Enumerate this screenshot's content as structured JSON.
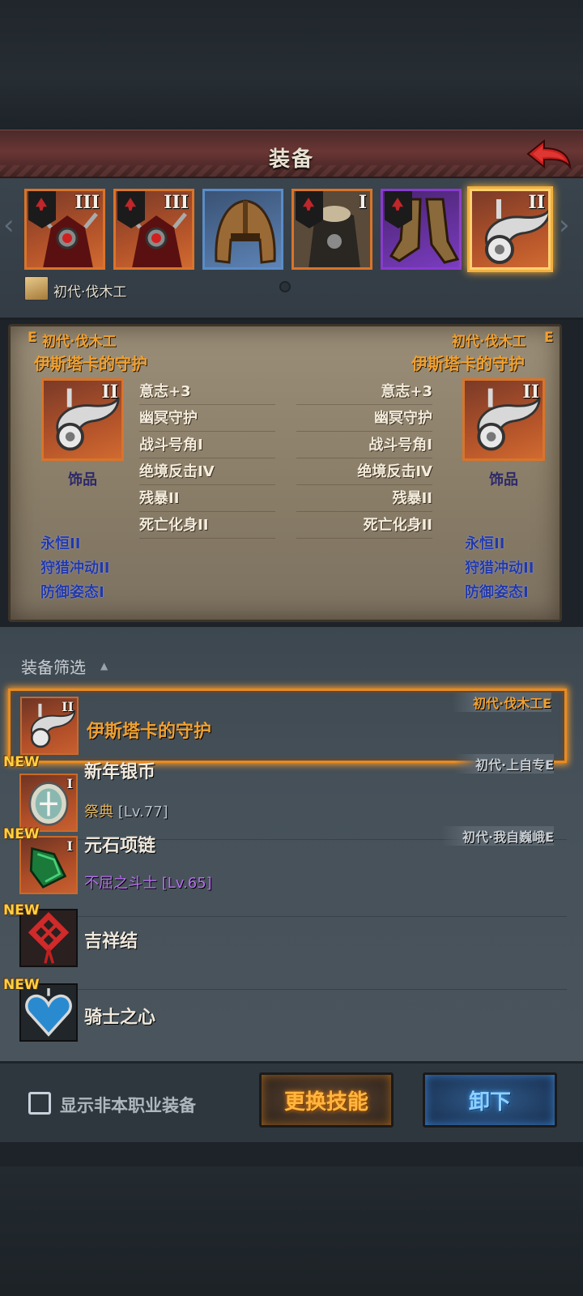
{
  "header": {
    "title": "装备"
  },
  "slots": [
    {
      "tier": "III",
      "frame": "orange",
      "icon": "demon-armor-icon"
    },
    {
      "tier": "III",
      "frame": "orange",
      "icon": "demon-armor-icon"
    },
    {
      "tier": "",
      "frame": "blue",
      "icon": "helmet-icon"
    },
    {
      "tier": "I",
      "frame": "orange",
      "icon": "fur-armor-icon"
    },
    {
      "tier": "",
      "frame": "purple",
      "icon": "boots-icon"
    },
    {
      "tier": "II",
      "frame": "orange",
      "icon": "horn-accessory-icon",
      "selected": true
    }
  ],
  "owner": {
    "name": "初代·伐木工"
  },
  "compare": {
    "left": {
      "owner": "初代·伐木工",
      "grade": "E",
      "name": "伊斯塔卡的守护",
      "tier": "II",
      "type": "饰品",
      "stats": [
        "意志+3",
        "幽冥守护",
        "战斗号角I",
        "绝境反击IV",
        "残暴II",
        "死亡化身II"
      ],
      "skills": [
        "永恒II",
        "狩猎冲动II",
        "防御姿态I"
      ]
    },
    "right": {
      "owner": "初代·伐木工",
      "grade": "E",
      "name": "伊斯塔卡的守护",
      "tier": "II",
      "type": "饰品",
      "stats": [
        "意志+3",
        "幽冥守护",
        "战斗号角I",
        "绝境反击IV",
        "残暴II",
        "死亡化身II"
      ],
      "skills": [
        "永恒II",
        "狩猎冲动II",
        "防御姿态I"
      ]
    }
  },
  "filter": {
    "label": "装备筛选",
    "caret": "▲"
  },
  "list": [
    {
      "name": "伊斯塔卡的守护",
      "tier": "II",
      "owner": "初代·伐木工E",
      "is_new": false,
      "sub": "",
      "level": "",
      "selected": true
    },
    {
      "name": "新年银币",
      "tier": "I",
      "owner": "初代·上自专E",
      "is_new": true,
      "new_label": "NEW",
      "sub": "祭典",
      "level": "[Lv.77]"
    },
    {
      "name": "元石项链",
      "tier": "I",
      "owner": "初代·我自巍峨E",
      "is_new": true,
      "new_label": "NEW",
      "sub": "不屈之斗士",
      "level": "[Lv.65]"
    },
    {
      "name": "吉祥结",
      "tier": "",
      "owner": "",
      "is_new": true,
      "new_label": "NEW",
      "sub": "",
      "level": ""
    },
    {
      "name": "骑士之心",
      "tier": "",
      "owner": "",
      "is_new": true,
      "new_label": "NEW",
      "sub": "",
      "level": ""
    }
  ],
  "footer": {
    "checkbox_label": "显示非本职业装备",
    "change_skill_label": "更换技能",
    "unequip_label": "卸下"
  },
  "colors": {
    "accent_orange": "#f0a030",
    "skill_blue": "#2238a8",
    "purple_text": "#b86ef0",
    "selected_border": "#e88a20"
  }
}
